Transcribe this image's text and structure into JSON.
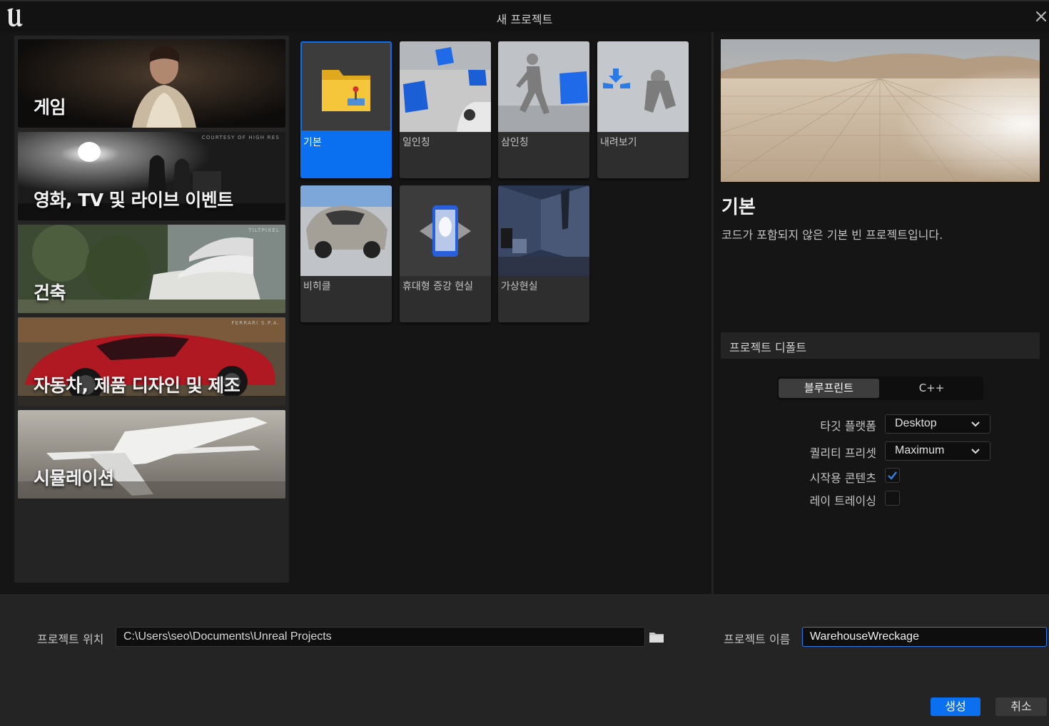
{
  "window": {
    "title": "새 프로젝트"
  },
  "categories": [
    {
      "label": "게임",
      "credit": "",
      "selected": true
    },
    {
      "label": "영화, TV 및 라이브 이벤트",
      "credit": "COURTESY OF HIGH RES"
    },
    {
      "label": "건축",
      "credit": "TILTPIXEL"
    },
    {
      "label": "자동차, 제품 디자인 및 제조",
      "credit": "FERRARI S.P.A."
    },
    {
      "label": "시뮬레이션",
      "credit": ""
    }
  ],
  "templates": [
    {
      "label": "기본",
      "selected": true
    },
    {
      "label": "일인칭"
    },
    {
      "label": "삼인칭"
    },
    {
      "label": "내려보기"
    },
    {
      "label": "비히클"
    },
    {
      "label": "휴대형 증강 현실"
    },
    {
      "label": "가상현실"
    }
  ],
  "details": {
    "title": "기본",
    "description": "코드가 포함되지 않은 기본 빈 프로젝트입니다.",
    "defaults_header": "프로젝트 디폴트",
    "lang_options": [
      "블루프린트",
      "C++"
    ],
    "lang_selected": "블루프린트",
    "target_platform_label": "타깃 플랫폼",
    "target_platform_value": "Desktop",
    "quality_preset_label": "퀄리티 프리셋",
    "quality_preset_value": "Maximum",
    "starter_content_label": "시작용 콘텐츠",
    "starter_content_checked": true,
    "raytracing_label": "레이 트레이싱",
    "raytracing_checked": false
  },
  "bottom": {
    "location_label": "프로젝트 위치",
    "location_value": "C:\\Users\\seo\\Documents\\Unreal Projects",
    "name_label": "프로젝트 이름",
    "name_value": "WarehouseWreckage",
    "create_label": "생성",
    "cancel_label": "취소"
  },
  "colors": {
    "accent": "#0a70f0",
    "background": "#151515",
    "panel": "#242424"
  }
}
